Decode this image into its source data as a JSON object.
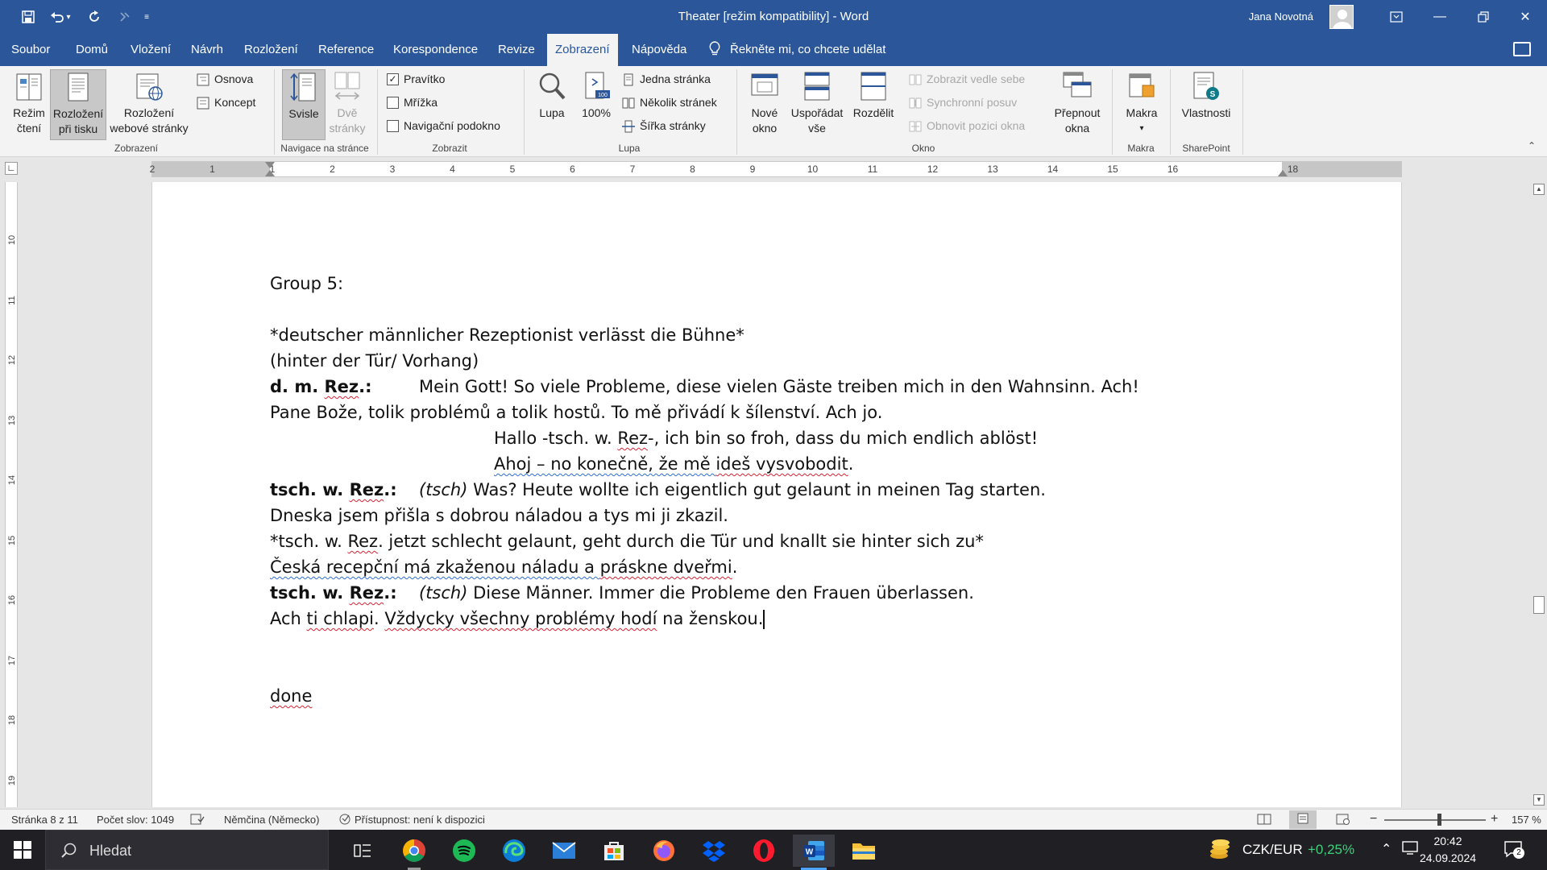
{
  "window": {
    "title": "Theater [režim kompatibility]  -  Word",
    "user_name": "Jana Novotná"
  },
  "tabs": [
    "Soubor",
    "Domů",
    "Vložení",
    "Návrh",
    "Rozložení",
    "Reference",
    "Korespondence",
    "Revize",
    "Zobrazení",
    "Nápověda"
  ],
  "active_tab": "Zobrazení",
  "tell_me": "Řekněte mi, co chcete udělat",
  "ribbon": {
    "views": {
      "read_mode": [
        "Režim",
        "čtení"
      ],
      "print_layout": [
        "Rozložení",
        "při tisku"
      ],
      "web_layout": [
        "Rozložení",
        "webové stránky"
      ],
      "outline": "Osnova",
      "draft": "Koncept",
      "group": "Zobrazení"
    },
    "page_movement": {
      "vertical": "Svisle",
      "side_by_side": [
        "Dvě",
        "stránky"
      ],
      "group": "Navigace na stránce"
    },
    "show": {
      "ruler": "Pravítko",
      "ruler_checked": true,
      "gridlines": "Mřížka",
      "gridlines_checked": false,
      "nav_pane": "Navigační podokno",
      "nav_pane_checked": false,
      "group": "Zobrazit"
    },
    "zoom": {
      "zoom": "Lupa",
      "hundred": "100%",
      "one_page": "Jedna stránka",
      "multiple_pages": "Několik stránek",
      "page_width": "Šířka stránky",
      "group": "Lupa"
    },
    "window": {
      "new_window": [
        "Nové",
        "okno"
      ],
      "arrange_all": [
        "Uspořádat",
        "vše"
      ],
      "split": "Rozdělit",
      "view_side_by_side": "Zobrazit vedle sebe",
      "sync_scroll": "Synchronní posuv",
      "reset_position": "Obnovit pozici okna",
      "switch_windows": [
        "Přepnout",
        "okna"
      ],
      "group": "Okno"
    },
    "macros": {
      "macros": "Makra",
      "group": "Makra"
    },
    "sharepoint": {
      "properties": "Vlastnosti",
      "group": "SharePoint"
    }
  },
  "ruler_ticks": [
    "2",
    "1",
    "1",
    "2",
    "3",
    "4",
    "5",
    "6",
    "7",
    "8",
    "9",
    "10",
    "11",
    "12",
    "13",
    "14",
    "15",
    "16",
    "18"
  ],
  "vruler_ticks": [
    "10",
    "11",
    "12",
    "13",
    "14",
    "15",
    "16",
    "17",
    "18",
    "19"
  ],
  "document": {
    "group": "Group 5:",
    "stage1": "*deutscher männlicher Rezeptionist verlässt die Bühne*",
    "stage2": "(hinter der Tür/ Vorhang)",
    "l1_speaker_a": "d. m. ",
    "l1_speaker_b": "Rez",
    "l1_speaker_c": ".:",
    "l1_text": "Mein Gott! So viele Probleme, diese vielen Gäste treiben mich in den Wahnsinn. Ach!",
    "l1_cz": "Pane Bože, tolik problémů a tolik hostů. To mě přivádí k šílenství. Ach jo.",
    "l2_a": "Hallo -tsch. w. ",
    "l2_b": "Rez",
    "l2_c": "-, ich bin so froh, dass du mich endlich ablöst!",
    "l2_cz_a": "Ahoj – no konečně, že mě ",
    "l2_cz_b": "ideš vysvobodit",
    "l2_cz_c": ".",
    "l3_speaker_a": "tsch. w. ",
    "l3_speaker_b": "Rez",
    "l3_speaker_c": ".:",
    "l3_ital": "(tsch)",
    "l3_text": " Was? Heute wollte ich eigentlich gut gelaunt in meinen Tag starten.",
    "l3_cz": "Dneska jsem přišla s dobrou náladou a tys mi ji zkazil.",
    "stage3_a": "*tsch. w. ",
    "stage3_b": "Rez",
    "stage3_c": ". jetzt schlecht gelaunt, geht durch die Tür und knallt sie hinter sich zu*",
    "stage3_cz_a": "Česká recepční má zkaženou náladu a ",
    "stage3_cz_b": "práskne dveřmi",
    "stage3_cz_c": ".",
    "l4_speaker_a": "tsch. w. ",
    "l4_speaker_b": "Rez",
    "l4_speaker_c": ".:",
    "l4_ital": "(tsch)",
    "l4_text": " Diese Männer. Immer die Probleme den Frauen überlassen.",
    "l4_cz_a": "Ach ",
    "l4_cz_b": "ti chlapi",
    "l4_cz_c": ". ",
    "l4_cz_d": "Vždycky všechny problémy hodí",
    "l4_cz_e": " na ženskou.",
    "done": "done"
  },
  "status": {
    "page": "Stránka 8 z 11",
    "words": "Počet slov: 1049",
    "language": "Němčina (Německo)",
    "accessibility": "Přístupnost: není k dispozici",
    "zoom_level": "157 %"
  },
  "taskbar": {
    "search": "Hledat",
    "currency": "CZK/EUR",
    "currency_change": "+0,25%",
    "time": "20:42",
    "date": "24.09.2024",
    "notifications": "2"
  },
  "colors": {
    "accent": "#2b579a",
    "ribbon_bg": "#f3f3f3",
    "spell_error": "#dd2233",
    "taskbar": "#1f1f24",
    "currency_up": "#3ed17a"
  }
}
